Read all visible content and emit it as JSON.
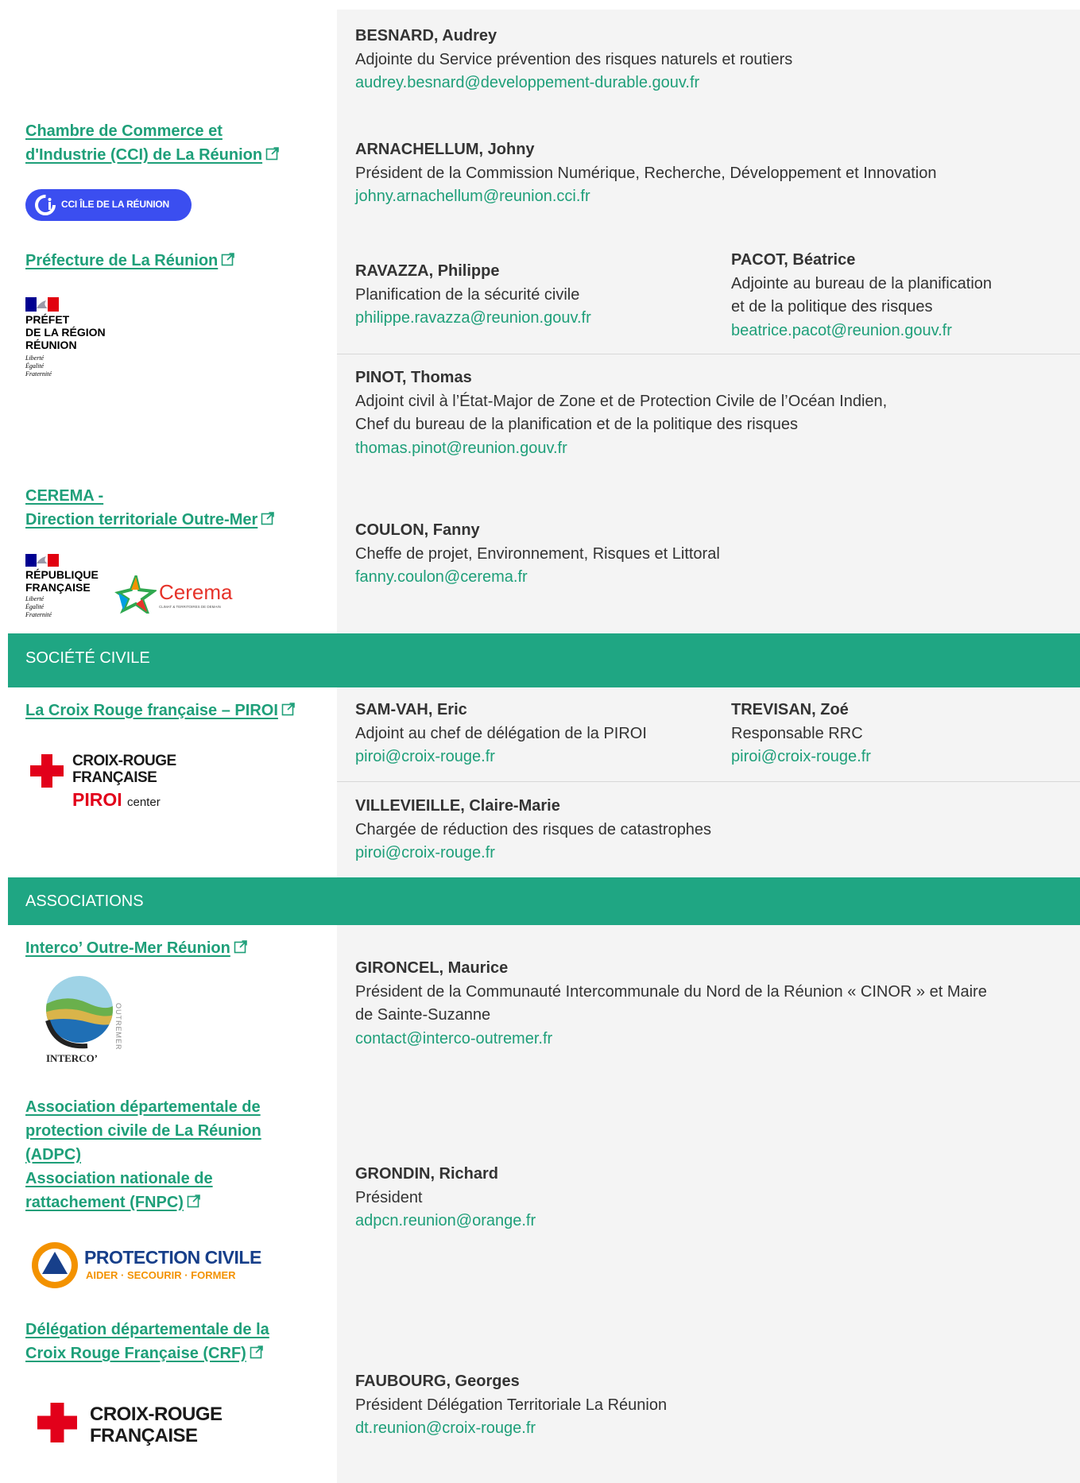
{
  "rows": {
    "dreal": {
      "contact": {
        "name": "BESNARD, Audrey",
        "role": "Adjointe du Service prévention des risques naturels et routiers",
        "email": "audrey.besnard@developpement-durable.gouv.fr"
      }
    },
    "cci": {
      "org_line1": "Chambre de Commerce et",
      "org_line2": "d'Industrie (CCI) de La Réunion",
      "logo_text": "CCI ÎLE DE LA RÉUNION",
      "contact": {
        "name": "ARNACHELLUM, Johny",
        "role": "Président de la Commission Numérique, Recherche, Développement et Innovation",
        "email": "johny.arnachellum@reunion.cci.fr"
      }
    },
    "prefecture": {
      "org": "Préfecture de La Réunion",
      "logo_lines": [
        "PRÉFET",
        "DE LA RÉGION",
        "RÉUNION"
      ],
      "logo_motto": [
        "Liberté",
        "Égalité",
        "Fraternité"
      ],
      "contact1": {
        "name": "RAVAZZA, Philippe",
        "role": "Planification de la sécurité civile",
        "email": "philippe.ravazza@reunion.gouv.fr"
      },
      "contact2": {
        "name": "PACOT, Béatrice",
        "role1": "Adjointe au bureau de la planification",
        "role2": "et de la politique des risques",
        "email": "beatrice.pacot@reunion.gouv.fr"
      },
      "contact3": {
        "name": "PINOT, Thomas",
        "role1": "Adjoint civil à l’État-Major de Zone et de Protection Civile de l’Océan Indien,",
        "role2": "Chef du bureau de la planification et de la politique des risques",
        "email": "thomas.pinot@reunion.gouv.fr"
      }
    },
    "cerema": {
      "org_line1": "CEREMA -",
      "org_line2": "Direction territoriale Outre-Mer",
      "logo_lines": [
        "RÉPUBLIQUE",
        "FRANÇAISE"
      ],
      "logo_motto": [
        "Liberté",
        "Égalité",
        "Fraternité"
      ],
      "cerema_logo": "Cerema",
      "cerema_tagline": "CLIMAT & TERRITOIRES DE DEMAIN",
      "contact": {
        "name": "COULON, Fanny",
        "role": "Cheffe de projet, Environnement, Risques et Littoral",
        "email": "fanny.coulon@cerema.fr"
      }
    },
    "croix_rouge_piroi": {
      "org": "La Croix Rouge française – PIROI",
      "logo_lines": [
        "CROIX-ROUGE",
        "FRANÇAISE"
      ],
      "logo_piroi": "PIROI",
      "logo_center": "center",
      "contact1": {
        "name": "SAM-VAH, Eric",
        "role": "Adjoint au chef de délégation de la PIROI",
        "email": "piroi@croix-rouge.fr"
      },
      "contact2": {
        "name": "TREVISAN, Zoé",
        "role": "Responsable RRC",
        "email": "piroi@croix-rouge.fr"
      },
      "contact3": {
        "name": "VILLEVIEILLE, Claire-Marie",
        "role": "Chargée de réduction des risques de catastrophes",
        "email": "piroi@croix-rouge.fr"
      }
    },
    "interco": {
      "org": "Interco’ Outre-Mer Réunion",
      "logo_side": "OUTREMER",
      "logo_text": "INTERCO’",
      "contact": {
        "name": "GIRONCEL, Maurice",
        "role1": "Président de la Communauté Intercommunale du Nord de la Réunion « CINOR » et Maire",
        "role2": "de Sainte-Suzanne",
        "email": "contact@interco-outremer.fr"
      }
    },
    "adpc": {
      "org_lines": [
        "Association départementale de",
        "protection civile de La Réunion",
        "(ADPC)",
        "Association nationale de",
        "rattachement (FNPC)"
      ],
      "logo_title": "PROTECTION CIVILE",
      "logo_sub": "AIDER · SECOURIR · FORMER",
      "contact": {
        "name": "GRONDIN, Richard",
        "role": "Président",
        "email": "adpcn.reunion@orange.fr"
      }
    },
    "crf": {
      "org_line1": "Délégation départementale de la",
      "org_line2": "Croix Rouge Française (CRF)",
      "logo_lines": [
        "CROIX-ROUGE",
        "FRANÇAISE"
      ],
      "contact": {
        "name": "FAUBOURG, Georges",
        "role": "Président Délégation Territoriale La Réunion",
        "email": "dt.reunion@croix-rouge.fr"
      }
    }
  },
  "sections": {
    "societe_civile": "SOCIÉTÉ CIVILE",
    "associations": "ASSOCIATIONS"
  },
  "colors": {
    "accent": "#1fa683",
    "link": "#1e9f79",
    "red_cross": "#e2001a",
    "blue_flag": "#000091",
    "cci_blue": "#3b4ef0"
  }
}
